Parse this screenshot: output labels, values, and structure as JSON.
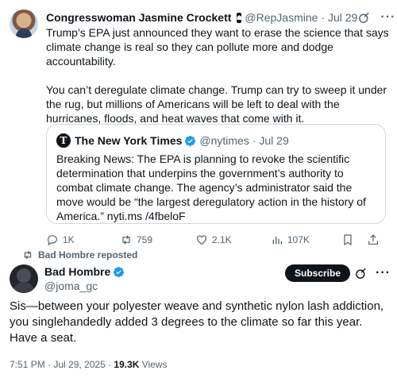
{
  "colors": {
    "verified": "#1d9bf0",
    "text": "#0f1419",
    "muted": "#536471",
    "border": "#cfd9de"
  },
  "post": {
    "author_name": "Congresswoman Jasmine Crockett",
    "handle": "@RepJasmine",
    "date": "· Jul 29",
    "paragraph1": "Trump’s EPA just announced they want to erase the science that says climate change is real so they can pollute more and dodge accountability.",
    "paragraph2": "You can’t deregulate climate change. Trump can try to sweep it under the rug, but millions of Americans will be left to deal with the hurricanes, floods, and heat waves that come with it.",
    "quote": {
      "logo_letter": "T",
      "author_name": "The New York Times",
      "handle": "@nytimes",
      "date": "· Jul 29",
      "text": "Breaking News: The EPA is planning to revoke the scientific determination that underpins the government’s authority to combat climate change. The agency’s administrator said the move would be “the largest deregulatory action in the history of America.” nyti.ms /4fbeloF"
    },
    "stats": {
      "replies": "1K",
      "reposts": "759",
      "likes": "2.1K",
      "views": "107K"
    }
  },
  "repost_banner": "Bad Hombre reposted",
  "reply": {
    "author_name": "Bad Hombre",
    "handle": "@joma_gc",
    "subscribe_label": "Subscribe",
    "text": "Sis—between your polyester weave and synthetic nylon lash addiction, you singlehandedly added 3 degrees to the climate so far this year. Have a seat.",
    "time": "7:51 PM · Jul 29, 2025 · ",
    "views_count": "19.3K",
    "views_label": " Views"
  }
}
